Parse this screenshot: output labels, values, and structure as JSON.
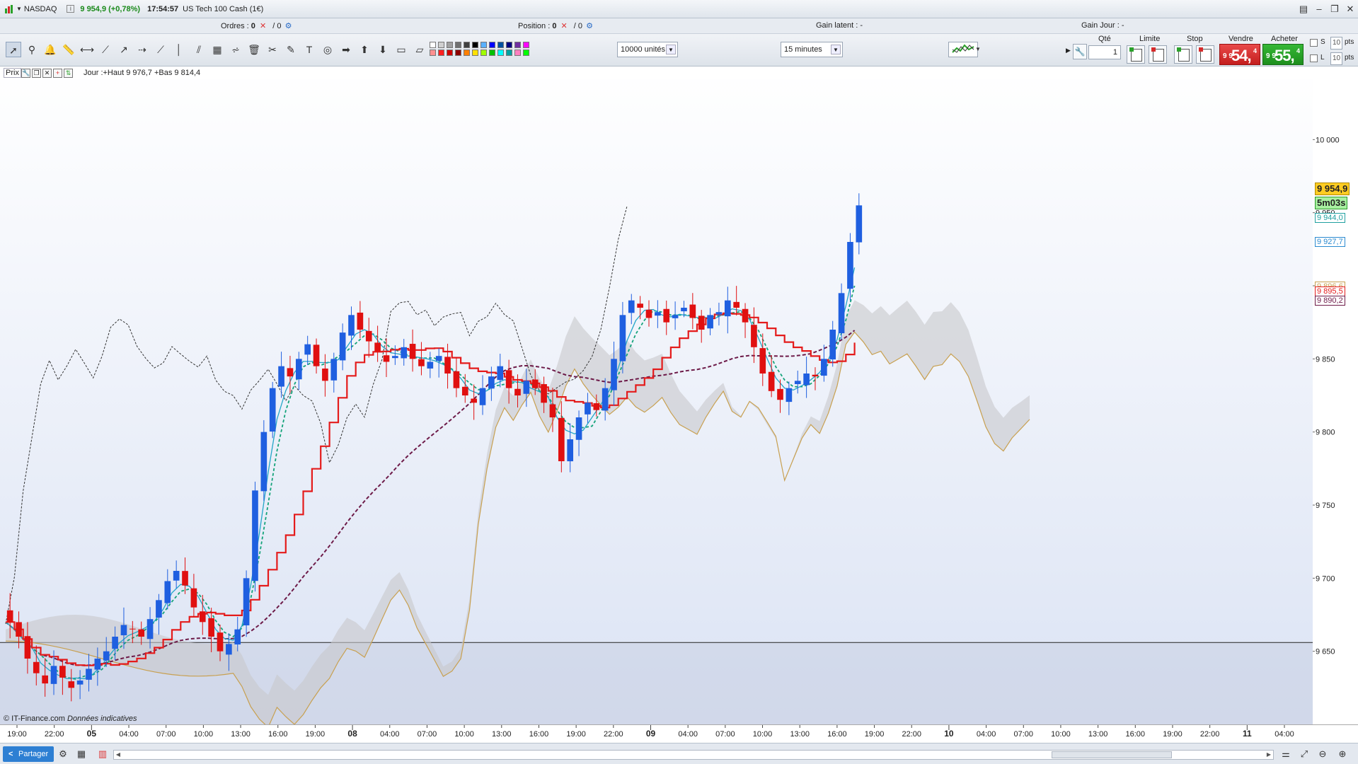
{
  "titlebar": {
    "market": "NASDAQ",
    "price_change": "9 954,9 (+0,78%)",
    "time": "17:54:57",
    "instrument": "US Tech 100 Cash (1€)",
    "window_buttons": [
      "▤",
      "–",
      "❐",
      "✕"
    ]
  },
  "inforow": {
    "orders_label": "Ordres :",
    "orders_value": "0",
    "orders_total": "/ 0",
    "position_label": "Position :",
    "position_value": "0",
    "position_total": "/ 0",
    "latent_label": "Gain latent : -",
    "day_label": "Gain Jour : -"
  },
  "toolbar": {
    "units_select": "10000 unités",
    "interval_select": "15 minutes",
    "tools": [
      "pointer",
      "zoom",
      "alarm",
      "ruler",
      "horizontal-line",
      "trend-line",
      "arrow-line",
      "segment",
      "vertical-line",
      "fibonacci",
      "channel",
      "fan",
      "delete",
      "chart-settings",
      "pen",
      "text",
      "fib-circle",
      "arrow",
      "up-arrow",
      "down-arrow",
      "rectangle",
      "rect-2"
    ],
    "palette_colors": [
      "#ffffff",
      "#d0d0d0",
      "#a0a0a0",
      "#707070",
      "#404040",
      "#000000",
      "#5ab0ff",
      "#0000ff",
      "#0050a0",
      "#000080",
      "#7030a0",
      "#ff00ff",
      "#ff9090",
      "#ff2020",
      "#d00000",
      "#8b0000",
      "#ff8000",
      "#ffe000",
      "#a0ff00",
      "#00c000",
      "#00ffff",
      "#00a0a0",
      "#ff80c0",
      "#00ff00"
    ]
  },
  "orderpanel": {
    "qty_label": "Qté",
    "qty_value": "1",
    "limit_label": "Limite",
    "stop_label": "Stop",
    "sell_label": "Vendre",
    "buy_label": "Acheter",
    "sell_prefix": "9 9",
    "sell_big": "54,",
    "sell_sup": "4",
    "buy_prefix": "9 9",
    "buy_big": "55,",
    "buy_sup": "4",
    "s_label": "S",
    "l_label": "L",
    "s_value": "10",
    "l_value": "10",
    "pts_label": "pts"
  },
  "chart": {
    "header_prix": "Prix",
    "header_info": "Jour :+Haut 9 976,7 +Bas 9 814,4",
    "credit": "© IT-Finance.com",
    "credit_note": "Données indicatives",
    "price_tags": {
      "last": "9 954,9",
      "countdown": "5m03s",
      "tag1": "9 944,0",
      "tag2": "9 927,7",
      "tag3": "9 896,6",
      "tag4": "9 895,5",
      "tag5": "9 890,2"
    },
    "colors": {
      "up": "#1f5fe0",
      "down": "#e01010",
      "kijun": "#e41b1b",
      "tenkan": "#22a6c8",
      "chikou": "#333333",
      "ma_green": "#14a37a",
      "ma_purple": "#6d1a48",
      "cloud": "#c8c8cc",
      "span_b": "#c8a050"
    },
    "y_ticks": [
      "10 000",
      "9 950",
      "9 900",
      "9 850",
      "9 800",
      "9 750",
      "9 700",
      "9 650"
    ],
    "x_ticks": [
      {
        "label": "19:00",
        "bold": false
      },
      {
        "label": "22:00",
        "bold": false
      },
      {
        "label": "05",
        "bold": true
      },
      {
        "label": "04:00",
        "bold": false
      },
      {
        "label": "07:00",
        "bold": false
      },
      {
        "label": "10:00",
        "bold": false
      },
      {
        "label": "13:00",
        "bold": false
      },
      {
        "label": "16:00",
        "bold": false
      },
      {
        "label": "19:00",
        "bold": false
      },
      {
        "label": "08",
        "bold": true
      },
      {
        "label": "04:00",
        "bold": false
      },
      {
        "label": "07:00",
        "bold": false
      },
      {
        "label": "10:00",
        "bold": false
      },
      {
        "label": "13:00",
        "bold": false
      },
      {
        "label": "16:00",
        "bold": false
      },
      {
        "label": "19:00",
        "bold": false
      },
      {
        "label": "22:00",
        "bold": false
      },
      {
        "label": "09",
        "bold": true
      },
      {
        "label": "04:00",
        "bold": false
      },
      {
        "label": "07:00",
        "bold": false
      },
      {
        "label": "10:00",
        "bold": false
      },
      {
        "label": "13:00",
        "bold": false
      },
      {
        "label": "16:00",
        "bold": false
      },
      {
        "label": "19:00",
        "bold": false
      },
      {
        "label": "22:00",
        "bold": false
      },
      {
        "label": "10",
        "bold": true
      },
      {
        "label": "04:00",
        "bold": false
      },
      {
        "label": "07:00",
        "bold": false
      },
      {
        "label": "10:00",
        "bold": false
      },
      {
        "label": "13:00",
        "bold": false
      },
      {
        "label": "16:00",
        "bold": false
      },
      {
        "label": "19:00",
        "bold": false
      },
      {
        "label": "22:00",
        "bold": false
      },
      {
        "label": "11",
        "bold": true
      },
      {
        "label": "04:00",
        "bold": false
      }
    ]
  },
  "chart_data": {
    "type": "candlestick",
    "instrument": "US Tech 100 Cash (1€)",
    "interval": "15 minutes",
    "y_range": [
      9600,
      10050
    ],
    "y_ticks": [
      9650,
      9700,
      9750,
      9800,
      9850,
      9900,
      9950,
      10000
    ],
    "horizontal_line": 9656,
    "last_price": 9954.9,
    "closes": [
      9670,
      9660,
      9645,
      9635,
      9628,
      9640,
      9632,
      9625,
      9630,
      9638,
      9645,
      9650,
      9660,
      9668,
      9665,
      9660,
      9672,
      9685,
      9698,
      9705,
      9695,
      9680,
      9670,
      9660,
      9650,
      9655,
      9665,
      9700,
      9760,
      9800,
      9830,
      9845,
      9838,
      9850,
      9860,
      9845,
      9835,
      9850,
      9868,
      9880,
      9870,
      9862,
      9855,
      9848,
      9852,
      9858,
      9850,
      9845,
      9848,
      9852,
      9840,
      9830,
      9825,
      9820,
      9830,
      9838,
      9845,
      9830,
      9825,
      9835,
      9830,
      9820,
      9810,
      9780,
      9795,
      9810,
      9820,
      9815,
      9830,
      9850,
      9880,
      9890,
      9885,
      9878,
      9882,
      9875,
      9880,
      9885,
      9878,
      9870,
      9880,
      9882,
      9890,
      9885,
      9875,
      9858,
      9840,
      9828,
      9822,
      9830,
      9835,
      9840,
      9838,
      9850,
      9870,
      9895,
      9930,
      9955
    ],
    "series": [
      {
        "name": "Kijun",
        "color": "#e41b1b"
      },
      {
        "name": "Tenkan",
        "color": "#22a6c8"
      },
      {
        "name": "Chikou",
        "color": "#333333"
      },
      {
        "name": "MA",
        "color": "#14a37a"
      },
      {
        "name": "MA-long",
        "color": "#6d1a48"
      }
    ]
  },
  "bottombar": {
    "share_label": "Partager"
  }
}
